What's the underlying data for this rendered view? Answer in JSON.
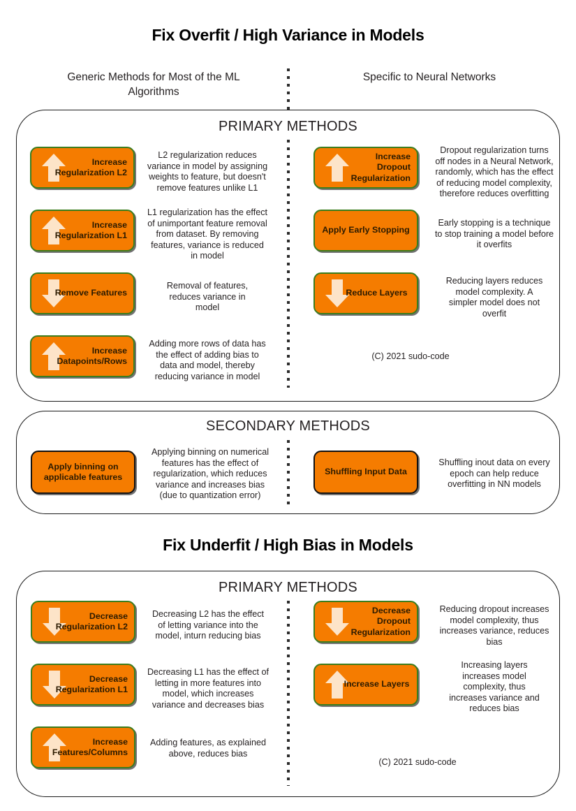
{
  "titles": {
    "overfit": "Fix Overfit / High Variance in Models",
    "underfit": "Fix Underfit / High Bias in Models"
  },
  "columns": {
    "generic": "Generic Methods for Most of\nthe ML Algorithms",
    "neural": "Specific to Neural\nNetworks"
  },
  "headings": {
    "primary": "PRIMARY METHODS",
    "secondary": "SECONDARY METHODS",
    "primary_underfit": "PRIMARY METHODS"
  },
  "colors": {
    "chip_fill": "#f57c00",
    "chip_border_green": "#3a7d1e",
    "chip_border_black": "#111111",
    "arrow_fill": "#fde4c8",
    "panel_border": "#1a1a1a",
    "text": "#231f20"
  },
  "overfit_primary": {
    "generic": [
      {
        "label": "Increase\nRegularization L2",
        "icon": "arrow-up-icon",
        "direction": "up",
        "desc": "L2 regularization reduces\nvariance in model  by assigning\nweights to feature, but doesn't\nremove features unlike L1"
      },
      {
        "label": "Increase\nRegularization L1",
        "icon": "arrow-up-icon",
        "direction": "up",
        "desc": "L1 regularization has the effect\nof unimportant feature removal\nfrom dataset. By removing\nfeatures, variance is reduced\nin model"
      },
      {
        "label": "Remove Features",
        "icon": "arrow-down-icon",
        "direction": "down",
        "desc": "Removal of features,\nreduces variance in\nmodel"
      },
      {
        "label": "Increase\nDatapoints/Rows",
        "icon": "arrow-up-icon",
        "direction": "up",
        "desc": "Adding more rows of data has\nthe effect of adding bias to\ndata and model, thereby\nreducing variance in model"
      }
    ],
    "neural": [
      {
        "label": "Increase\nDropout\nRegularization",
        "icon": "arrow-up-icon",
        "direction": "up",
        "desc": "Dropout regularization turns\noff nodes in a Neural Network,\nrandomly, which has the effect\nof reducing model complexity,\ntherefore reduces overfitting"
      },
      {
        "label": "Apply Early Stopping",
        "icon": "none",
        "direction": "none",
        "desc": "Early stopping is a technique\nto stop training a model before\nit overfits"
      },
      {
        "label": "Reduce Layers",
        "icon": "arrow-down-icon",
        "direction": "down",
        "desc": "Reducing layers reduces\nmodel complexity. A\nsimpler model does not\noverfit"
      }
    ],
    "copyright": "(C) 2021 sudo-code"
  },
  "overfit_secondary": {
    "generic": [
      {
        "label": "Apply binning on\napplicable features",
        "icon": "none",
        "direction": "none",
        "desc": "Applying binning on numerical\nfeatures has the effect of\nregularization, which reduces\nvariance and increases bias\n(due to quantization error)"
      }
    ],
    "neural": [
      {
        "label": "Shuffling Input Data",
        "icon": "none",
        "direction": "none",
        "desc": "Shuffling inout data on every\nepoch can help reduce\noverfitting in NN models"
      }
    ]
  },
  "underfit_primary": {
    "generic": [
      {
        "label": "Decrease\nRegularization L2",
        "icon": "arrow-down-icon",
        "direction": "down",
        "desc": "Decreasing L2 has the effect\nof letting variance into the\nmodel, inturn reducing bias"
      },
      {
        "label": "Decrease\nRegularization L1",
        "icon": "arrow-down-icon",
        "direction": "down",
        "desc": "Decreasing L1 has the effect of\nletting in more features into\nmodel, which increases\nvariance and decreases bias"
      },
      {
        "label": "Increase\nFeatures/Columns",
        "icon": "arrow-up-icon",
        "direction": "up",
        "desc": "Adding features, as explained\nabove, reduces bias"
      }
    ],
    "neural": [
      {
        "label": "Decrease\nDropout\nRegularization",
        "icon": "arrow-down-icon",
        "direction": "down",
        "desc": "Reducing dropout increases\nmodel complexity, thus\nincreases variance, reduces\nbias"
      },
      {
        "label": "Increase Layers",
        "icon": "arrow-up-icon",
        "direction": "up",
        "desc": "Increasing layers\nincreases model\ncomplexity, thus\nincreases variance and\nreduces bias"
      }
    ],
    "copyright": "(C) 2021 sudo-code"
  }
}
